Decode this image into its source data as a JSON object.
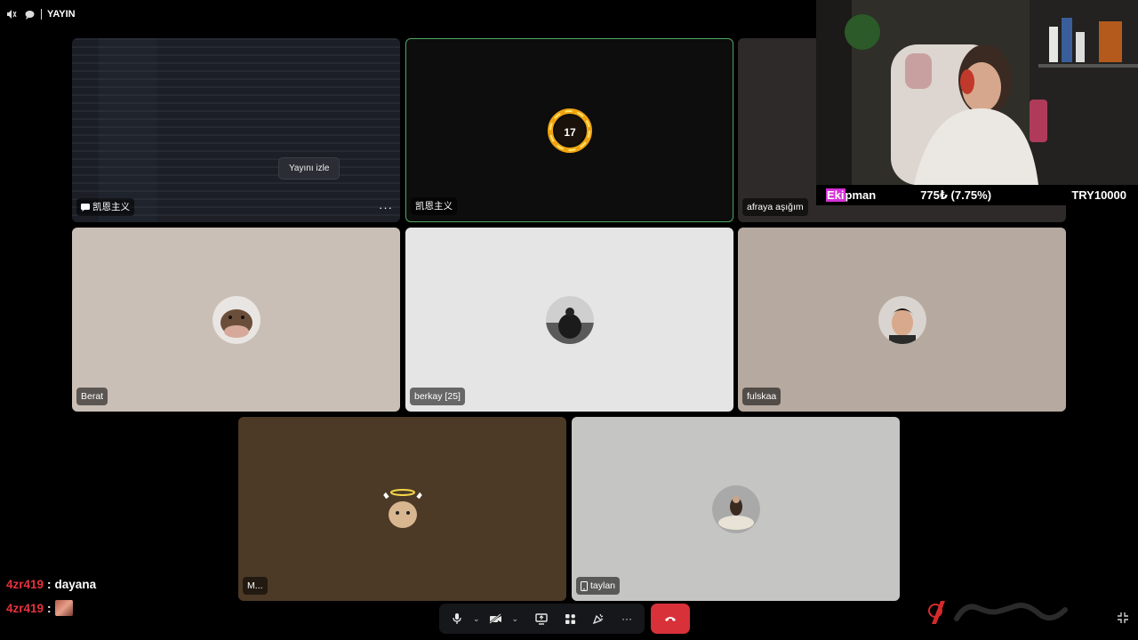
{
  "topbar": {
    "label": "YAYIN"
  },
  "tiles": [
    {
      "name": "凯恩主义",
      "overlay_button": "Yayını izle",
      "has_chat_icon": true,
      "has_more": true
    },
    {
      "name": "凯恩主义",
      "speaking": true,
      "accent": "#4fa863"
    },
    {
      "name": "afraya aşığım"
    },
    {
      "name": "Berat"
    },
    {
      "name": "berkay [25]"
    },
    {
      "name": "fulskaa"
    },
    {
      "name": "M..."
    },
    {
      "name": "taylan",
      "device": "mobile-icon"
    }
  ],
  "stream_overlay": {
    "ticker": {
      "label_highlight": "Eki",
      "label_rest": "pman",
      "amount": "775₺ (7.75%)",
      "target": "TRY10000",
      "highlight_color": "#d630d6"
    }
  },
  "chat": [
    {
      "user": "4zr419",
      "message": "dayana"
    },
    {
      "user": "4zr419",
      "message": "",
      "emote": "face-emote"
    }
  ],
  "toolbar": {
    "buttons": [
      "microphone-icon",
      "camera-off-icon",
      "screen-share-icon",
      "activities-icon",
      "soundboard-icon",
      "more-icon"
    ],
    "hangup": "phone-hangup-icon",
    "hangup_color": "#d8313a"
  },
  "colors": {
    "background": "#000000",
    "chat_user": "#e7323d"
  }
}
